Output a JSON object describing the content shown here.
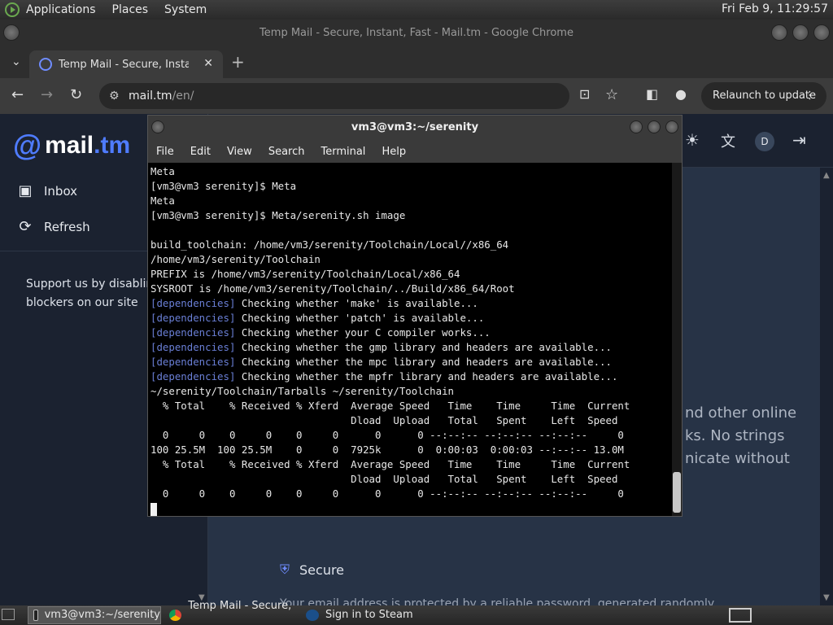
{
  "top_panel": {
    "menus": [
      "Applications",
      "Places",
      "System"
    ],
    "clock": "Fri Feb  9, 11:29:57"
  },
  "chrome": {
    "window_title": "Temp Mail - Secure, Instant, Fast - Mail.tm - Google Chrome",
    "tab_title": "Temp Mail - Secure, Instant, Fast - Mail.tm",
    "tab_close": "✕",
    "new_tab": "+",
    "url_host": "mail.tm",
    "url_path": "/en/",
    "relaunch_label": "Relaunch to update"
  },
  "page": {
    "brand_at": "@",
    "brand_name": "mail",
    "brand_tld": ".tm",
    "nav": [
      {
        "label": "Inbox",
        "icon": "inbox-icon"
      },
      {
        "label": "Refresh",
        "icon": "refresh-icon"
      }
    ],
    "support_text": "Support us by disabling ad blockers on our site",
    "avatar_initial": "D",
    "content_lines": [
      "nd other online",
      "ks. No strings",
      "nicate without"
    ],
    "secure_title": "Secure",
    "secure_desc": "Your email address is protected by a reliable password, generated randomly"
  },
  "terminal": {
    "title": "vm3@vm3:~/serenity",
    "menus": [
      "File",
      "Edit",
      "View",
      "Search",
      "Terminal",
      "Help"
    ],
    "lines": [
      {
        "text": "Meta"
      },
      {
        "text": "[vm3@vm3 serenity]$ Meta"
      },
      {
        "text": "Meta"
      },
      {
        "text": "[vm3@vm3 serenity]$ Meta/serenity.sh image"
      },
      {
        "text": ""
      },
      {
        "text": "build_toolchain: /home/vm3/serenity/Toolchain/Local//x86_64"
      },
      {
        "text": "/home/vm3/serenity/Toolchain"
      },
      {
        "text": "PREFIX is /home/vm3/serenity/Toolchain/Local/x86_64"
      },
      {
        "text": "SYSROOT is /home/vm3/serenity/Toolchain/../Build/x86_64/Root"
      },
      {
        "prefix": "[dependencies]",
        "text": " Checking whether 'make' is available..."
      },
      {
        "prefix": "[dependencies]",
        "text": " Checking whether 'patch' is available..."
      },
      {
        "prefix": "[dependencies]",
        "text": " Checking whether your C compiler works..."
      },
      {
        "prefix": "[dependencies]",
        "text": " Checking whether the gmp library and headers are available..."
      },
      {
        "prefix": "[dependencies]",
        "text": " Checking whether the mpc library and headers are available..."
      },
      {
        "prefix": "[dependencies]",
        "text": " Checking whether the mpfr library and headers are available..."
      },
      {
        "text": "~/serenity/Toolchain/Tarballs ~/serenity/Toolchain"
      },
      {
        "text": "  % Total    % Received % Xferd  Average Speed   Time    Time     Time  Current"
      },
      {
        "text": "                                 Dload  Upload   Total   Spent    Left  Speed"
      },
      {
        "text": "  0     0    0     0    0     0      0      0 --:--:-- --:--:-- --:--:--     0"
      },
      {
        "text": "100 25.5M  100 25.5M    0     0  7925k      0  0:00:03  0:00:03 --:--:-- 13.0M"
      },
      {
        "text": "  % Total    % Received % Xferd  Average Speed   Time    Time     Time  Current"
      },
      {
        "text": "                                 Dload  Upload   Total   Spent    Left  Speed"
      },
      {
        "text": "  0     0    0     0    0     0      0      0 --:--:-- --:--:-- --:--:--     0"
      }
    ]
  },
  "taskbar": {
    "tasks": [
      {
        "label": "vm3@vm3:~/serenity",
        "icon": "terminal-icon",
        "active": true
      },
      {
        "label": "Temp Mail - Secure, ...",
        "icon": "chrome-icon",
        "active": false
      },
      {
        "label": "Sign in to Steam",
        "icon": "steam-icon",
        "active": false
      }
    ]
  },
  "colors": {
    "accent": "#4f7cff",
    "dependency_tag": "#6a7fd6"
  }
}
